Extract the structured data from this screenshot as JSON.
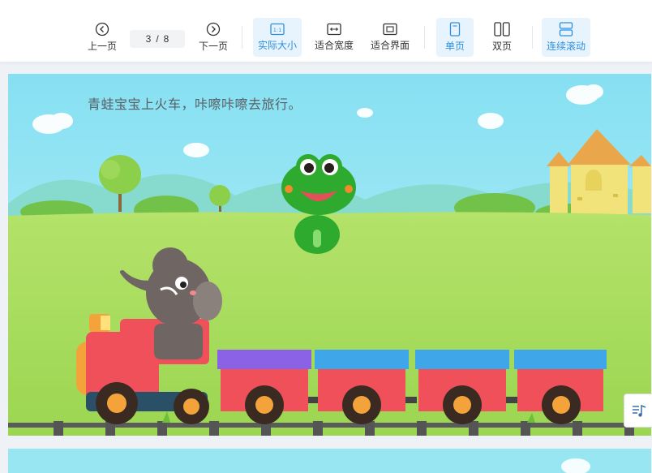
{
  "toolbar": {
    "prev_label": "上一页",
    "next_label": "下一页",
    "current_page": "3",
    "page_separator": "/",
    "total_pages": "8",
    "actual_size_label": "实际大小",
    "fit_width_label": "适合宽度",
    "fit_page_label": "适合界面",
    "single_page_label": "单页",
    "double_page_label": "双页",
    "continuous_scroll_label": "连续滚动",
    "active_color": "#2b8fe0",
    "active_bg": "#e8f4fd"
  },
  "page": {
    "story_text": "青蛙宝宝上火车，咔嚓咔嚓去旅行。",
    "sky_color": "#9be8f5",
    "grass_color": "#a8dc5a"
  },
  "icons": {
    "prev": "chevron-left-circle-icon",
    "next": "chevron-right-circle-icon",
    "actual_size": "one-to-one-icon",
    "fit_width": "fit-width-icon",
    "fit_page": "fit-page-icon",
    "single_page": "single-page-icon",
    "double_page": "double-page-icon",
    "continuous_scroll": "continuous-scroll-icon",
    "audio": "music-list-icon"
  }
}
